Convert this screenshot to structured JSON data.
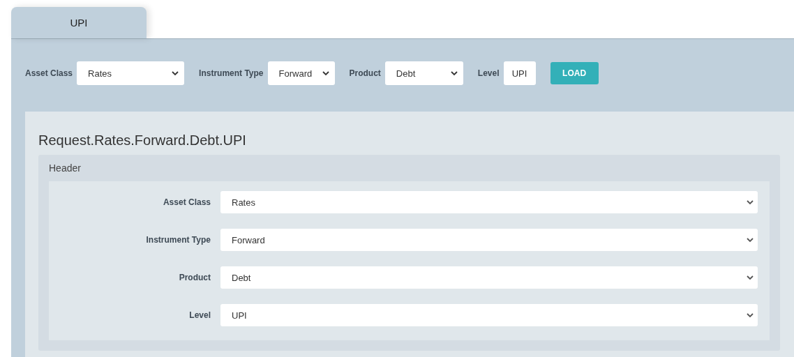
{
  "tabs": [
    {
      "label": "UPI",
      "selected": true
    }
  ],
  "filters": [
    {
      "label": "Asset Class",
      "kind": "select",
      "value": "Rates"
    },
    {
      "label": "Instrument Type",
      "kind": "select",
      "value": "Forward"
    },
    {
      "label": "Product",
      "kind": "select",
      "value": "Debt"
    },
    {
      "label": "Level",
      "kind": "input",
      "value": "UPI"
    }
  ],
  "load_button": "LOAD",
  "request_title": "Request.Rates.Forward.Debt.UPI",
  "section": {
    "title": "Header",
    "fields": [
      {
        "label": "Asset Class",
        "value": "Rates"
      },
      {
        "label": "Instrument Type",
        "value": "Forward"
      },
      {
        "label": "Product",
        "value": "Debt"
      },
      {
        "label": "Level",
        "value": "UPI"
      }
    ]
  }
}
